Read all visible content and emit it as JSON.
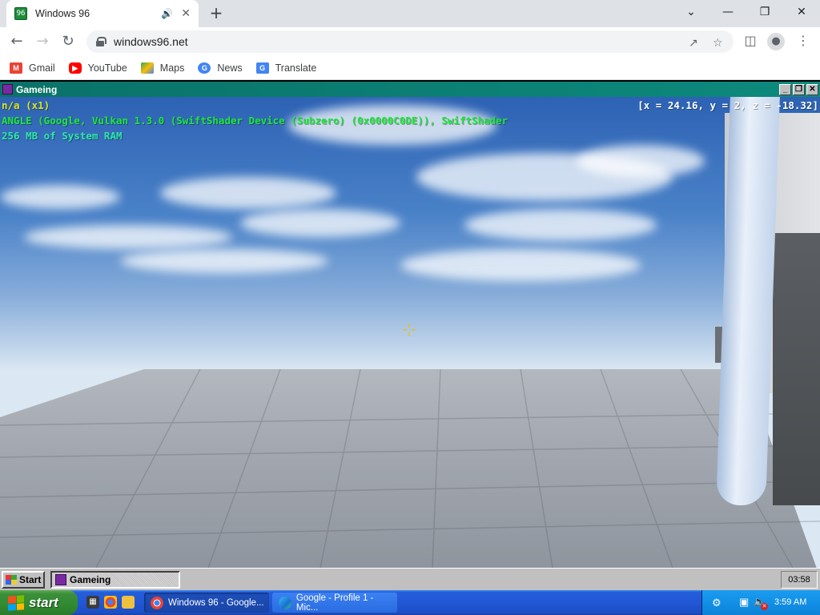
{
  "browser": {
    "tab": {
      "title": "Windows 96",
      "favicon": "windows96-favicon"
    },
    "url": "windows96.net",
    "bookmarks": [
      {
        "label": "Gmail",
        "icon": "gmail-icon",
        "color": "#ea4335"
      },
      {
        "label": "YouTube",
        "icon": "youtube-icon",
        "color": "#ff0000"
      },
      {
        "label": "Maps",
        "icon": "maps-icon",
        "color": "#34a853"
      },
      {
        "label": "News",
        "icon": "news-icon",
        "color": "#4285f4"
      },
      {
        "label": "Translate",
        "icon": "translate-icon",
        "color": "#4285f4"
      }
    ]
  },
  "w96": {
    "window_title": "Gameing",
    "hud": {
      "line1": "n/a (x1)",
      "line2": "ANGLE (Google, Vulkan 1.3.0 (SwiftShader Device (Subzero) (0x0000C0DE)), SwiftShader",
      "line3": "256 MB of System RAM",
      "coords": "[x = 24.16, y = 2, z = -18.32]",
      "line1_color": "#d8e818",
      "line2_color": "#1ee83a",
      "line3_color": "#2ee8a8",
      "coords_color": "#ffffff"
    },
    "taskbar": {
      "start_label": "Start",
      "task_label": "Gameing",
      "clock": "03:58"
    }
  },
  "xp": {
    "start_label": "start",
    "tasks": [
      {
        "label": "Windows 96 - Google...",
        "icon": "chrome-icon"
      },
      {
        "label": "Google - Profile 1 - Mic...",
        "icon": "edge-icon"
      }
    ],
    "clock": "3:59 AM"
  }
}
